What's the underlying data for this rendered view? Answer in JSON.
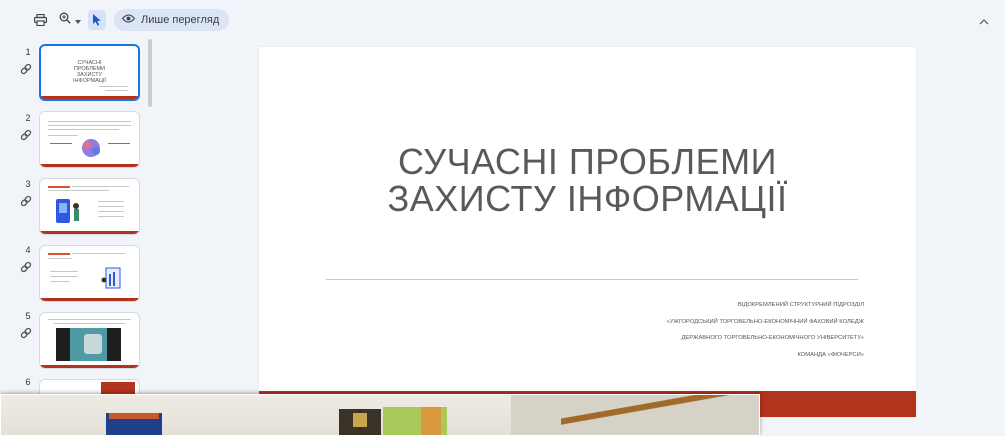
{
  "toolbar": {
    "view_only_label": "Лише перегляд",
    "icons": [
      "print-icon",
      "zoom-icon",
      "chevron-down-icon",
      "cursor-icon",
      "eye-icon",
      "chevron-up-icon"
    ]
  },
  "slides": [
    {
      "number": "1",
      "title": "СУЧАСНІ ПРОБЛЕМИ ЗАХИСТУ ІНФОРМАЦІЇ",
      "selected": true
    },
    {
      "number": "2"
    },
    {
      "number": "3"
    },
    {
      "number": "4"
    },
    {
      "number": "5"
    },
    {
      "number": "6"
    }
  ],
  "main_slide": {
    "title_line1": "СУЧАСНІ ПРОБЛЕМИ",
    "title_line2": "ЗАХИСТУ ІНФОРМАЦІЇ",
    "info": [
      "ВІДОКРЕМЛЕНИЙ СТРУКТУРНИЙ ПІДРОЗДІЛ",
      "«УЖГОРОДСЬКИЙ ТОРГОВЕЛЬНО-ЕКОНОМІЧНИЙ ФАХОВИЙ КОЛЕДЖ",
      "ДЕРЖАВНОГО ТОРГОВЕЛЬНО-ЕКОНОМІЧНОГО УНІВЕРСИТЕТУ»",
      "КОМАНДА «ФЮЧЕРСИ»"
    ],
    "accent_color": "#b3341d"
  },
  "colors": {
    "selection": "#1a73e8",
    "background": "#f1f4f9"
  }
}
